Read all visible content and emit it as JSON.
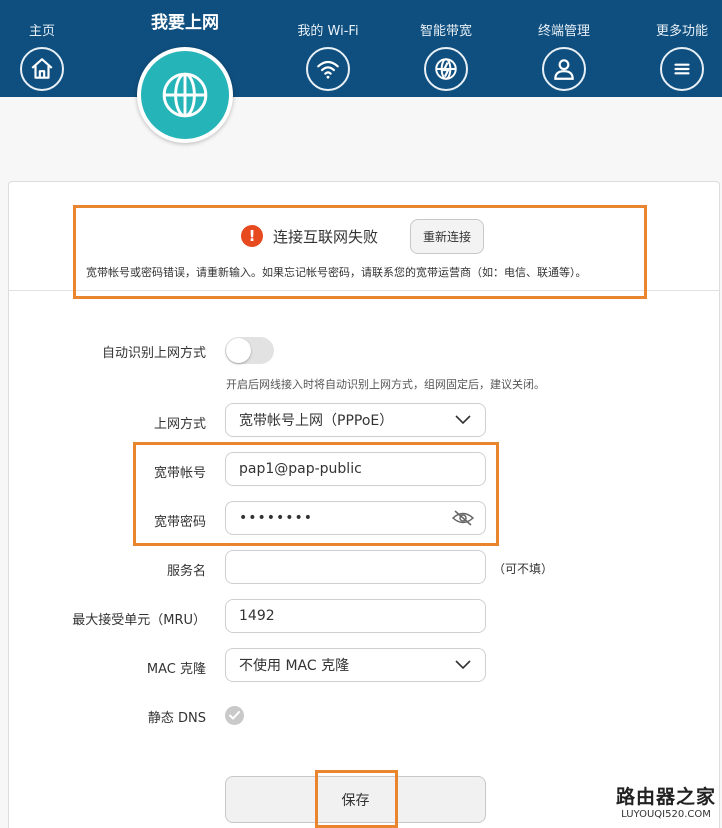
{
  "nav": {
    "items": [
      {
        "label": "主页",
        "icon": "home-icon"
      },
      {
        "label": "我要上网",
        "icon": "globe-icon",
        "active": true
      },
      {
        "label": "我的 Wi-Fi",
        "icon": "wifi-icon"
      },
      {
        "label": "智能带宽",
        "icon": "bandwidth-globe-icon"
      },
      {
        "label": "终端管理",
        "icon": "user-icon"
      },
      {
        "label": "更多功能",
        "icon": "menu-icon"
      }
    ]
  },
  "status": {
    "icon": "error-icon",
    "title": "连接互联网失败",
    "reconnect_label": "重新连接",
    "message": "宽带帐号或密码错误，请重新输入。如果忘记帐号密码，请联系您的宽带运营商（如：电信、联通等）。"
  },
  "form": {
    "auto_detect_label": "自动识别上网方式",
    "auto_detect_hint": "开启后网线接入时将自动识别上网方式，组网固定后，建议关闭。",
    "auto_detect_on": false,
    "mode_label": "上网方式",
    "mode_value": "宽带帐号上网（PPPoE）",
    "account_label": "宽带帐号",
    "account_value": "pap1@pap-public",
    "password_label": "宽带密码",
    "password_value": "••••••••",
    "service_label": "服务名",
    "service_value": "",
    "service_hint": "（可不填）",
    "mru_label": "最大接受单元（MRU）",
    "mru_value": "1492",
    "mac_label": "MAC 克隆",
    "mac_value": "不使用 MAC 克隆",
    "dns_label": "静态 DNS",
    "save_label": "保存"
  },
  "watermark": {
    "cn": "路由器之家",
    "en": "LUYOUQI520.COM"
  },
  "colors": {
    "header": "#0f4f7f",
    "active": "#25b4b8",
    "highlight": "#e9842f",
    "error": "#e84a1f"
  }
}
